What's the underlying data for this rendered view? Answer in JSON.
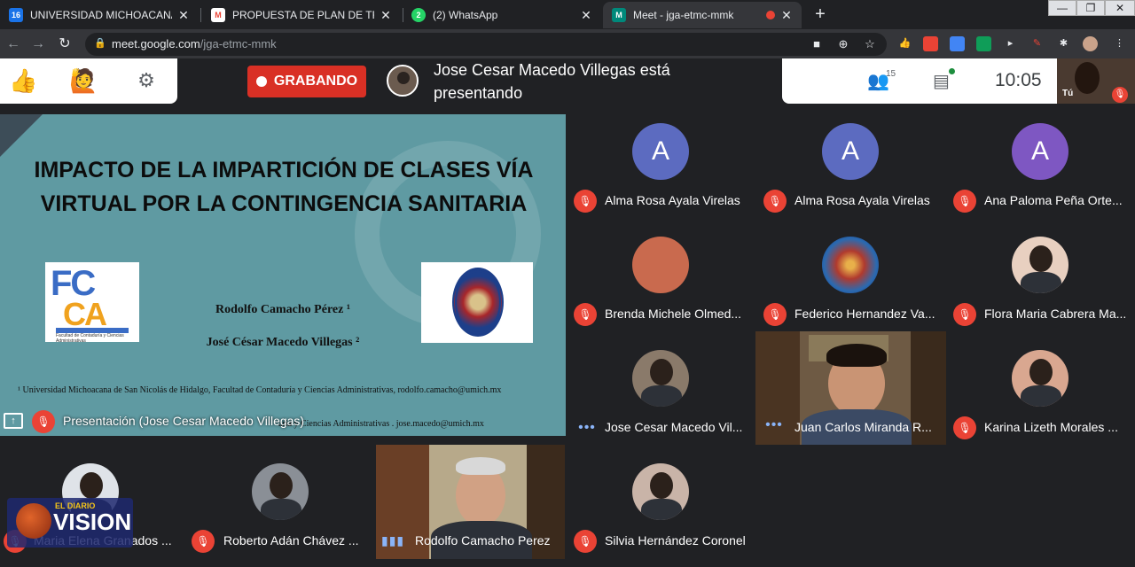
{
  "browser": {
    "tabs": [
      {
        "label": "UNIVERSIDAD MICHOACANA DE",
        "favicon": "16",
        "favicon_color": "#1a73e8"
      },
      {
        "label": "PROPUESTA DE PLAN DE TRABAJ",
        "favicon": "M",
        "favicon_color": "#ea4335"
      },
      {
        "label": "(2) WhatsApp",
        "favicon": "2",
        "favicon_color": "#25d366"
      },
      {
        "label": "Meet - jga-etmc-mmk",
        "favicon": "M",
        "favicon_color": "#00897b"
      }
    ],
    "new_tab": "+",
    "window_controls": [
      "—",
      "❐",
      "✕"
    ],
    "url_host": "meet.google.com",
    "url_path": "/jga-etmc-mmk"
  },
  "meet": {
    "recording_label": "GRABANDO",
    "presenter_banner": "Jose Cesar Macedo Villegas está presentando",
    "participants_count": "15",
    "clock": "10:05",
    "self_label": "Tú",
    "presentation_label": "Presentación (Jose Cesar Macedo Villegas)"
  },
  "slide": {
    "title": "IMPACTO DE LA IMPARTICIÓN DE CLASES VÍA VIRTUAL POR LA CONTINGENCIA SANITARIA",
    "author1": "Rodolfo Camacho Pérez ¹",
    "author2": "José César Macedo Villegas ²",
    "affiliation1": "¹ Universidad Michoacana de San Nicolás de Hidalgo, Facultad de Contaduría y Ciencias Administrativas, rodolfo.camacho@umich.mx",
    "affiliation2_visible": "aria y Ciencias Administrativas . jose.macedo@umich.mx",
    "logo1_text_top": "FC",
    "logo1_text_bottom": "CA",
    "logo1_caption": "Facultad de Contaduría y Ciencias Administrativas"
  },
  "participants": [
    {
      "name": "Alma Rosa Ayala Virelas",
      "initial": "A",
      "color": "#5c6bc0",
      "status": "muted"
    },
    {
      "name": "Alma Rosa Ayala Virelas",
      "initial": "A",
      "color": "#5c6bc0",
      "status": "muted"
    },
    {
      "name": "Ana Paloma Peña Orte...",
      "initial": "A",
      "color": "#7e57c2",
      "status": "muted"
    },
    {
      "name": "Brenda Michele Olmed...",
      "initial": "",
      "color": "#c96a4e",
      "status": "muted"
    },
    {
      "name": "Federico Hernandez Va...",
      "initial": "",
      "color": "#b03a2e",
      "status": "muted"
    },
    {
      "name": "Flora Maria Cabrera Ma...",
      "initial": "",
      "color": "#e8d0c0",
      "status": "muted"
    },
    {
      "name": "Jose Cesar Macedo Vil...",
      "initial": "",
      "color": "#8a7a6a",
      "status": "more"
    },
    {
      "name": "Juan Carlos Miranda R...",
      "initial": "",
      "color": "#6e5a44",
      "status": "more"
    },
    {
      "name": "Karina Lizeth Morales ...",
      "initial": "",
      "color": "#d9a790",
      "status": "muted"
    },
    {
      "name": "Silvia Hernández Coronel",
      "initial": "",
      "color": "#c9b4a8",
      "status": "muted"
    }
  ],
  "bottom_row": [
    {
      "name": "Maria Elena Granados ...",
      "status": "muted"
    },
    {
      "name": "Roberto Adán Chávez ...",
      "status": "muted"
    },
    {
      "name": "Rodolfo Camacho Perez",
      "status": "speaking"
    }
  ],
  "watermark": {
    "top": "EL DIARIO",
    "text": "VISION"
  }
}
